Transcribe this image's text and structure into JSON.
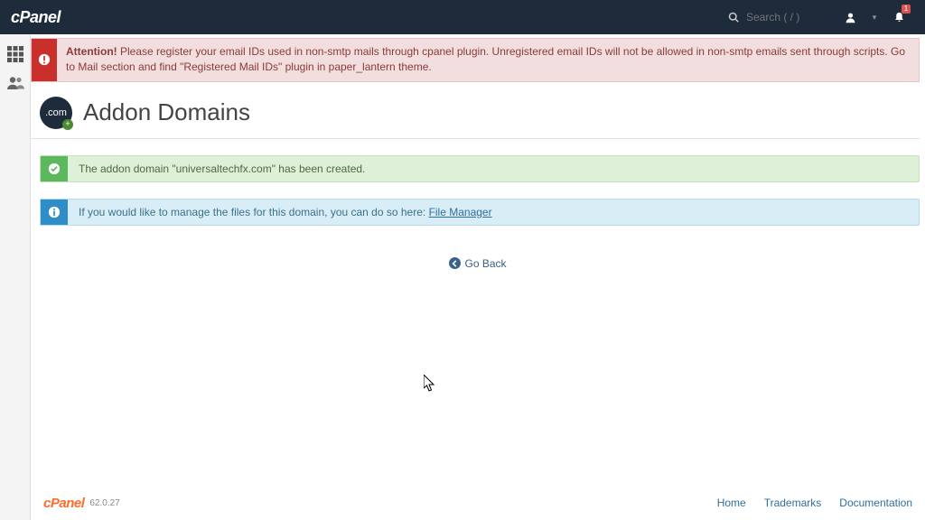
{
  "header": {
    "logo": "cPanel",
    "search_placeholder": "Search ( / )",
    "notification_count": "1"
  },
  "alerts": {
    "attention_label": "Attention!",
    "attention_text": " Please register your email IDs used in non-smtp mails through cpanel plugin. Unregistered email IDs will not be allowed in non-smtp emails sent through scripts. Go to Mail section and find \"Registered Mail IDs\" plugin in paper_lantern theme.",
    "success_text": "The addon domain \"universaltechfx.com\" has been created.",
    "info_prefix": "If you would like to manage the files for this domain, you can do so here: ",
    "info_link": "File Manager"
  },
  "page": {
    "title": "Addon Domains",
    "icon_text": ".com",
    "go_back": "Go Back"
  },
  "footer": {
    "logo": "cPanel",
    "version": "62.0.27",
    "links": [
      "Home",
      "Trademarks",
      "Documentation"
    ]
  }
}
